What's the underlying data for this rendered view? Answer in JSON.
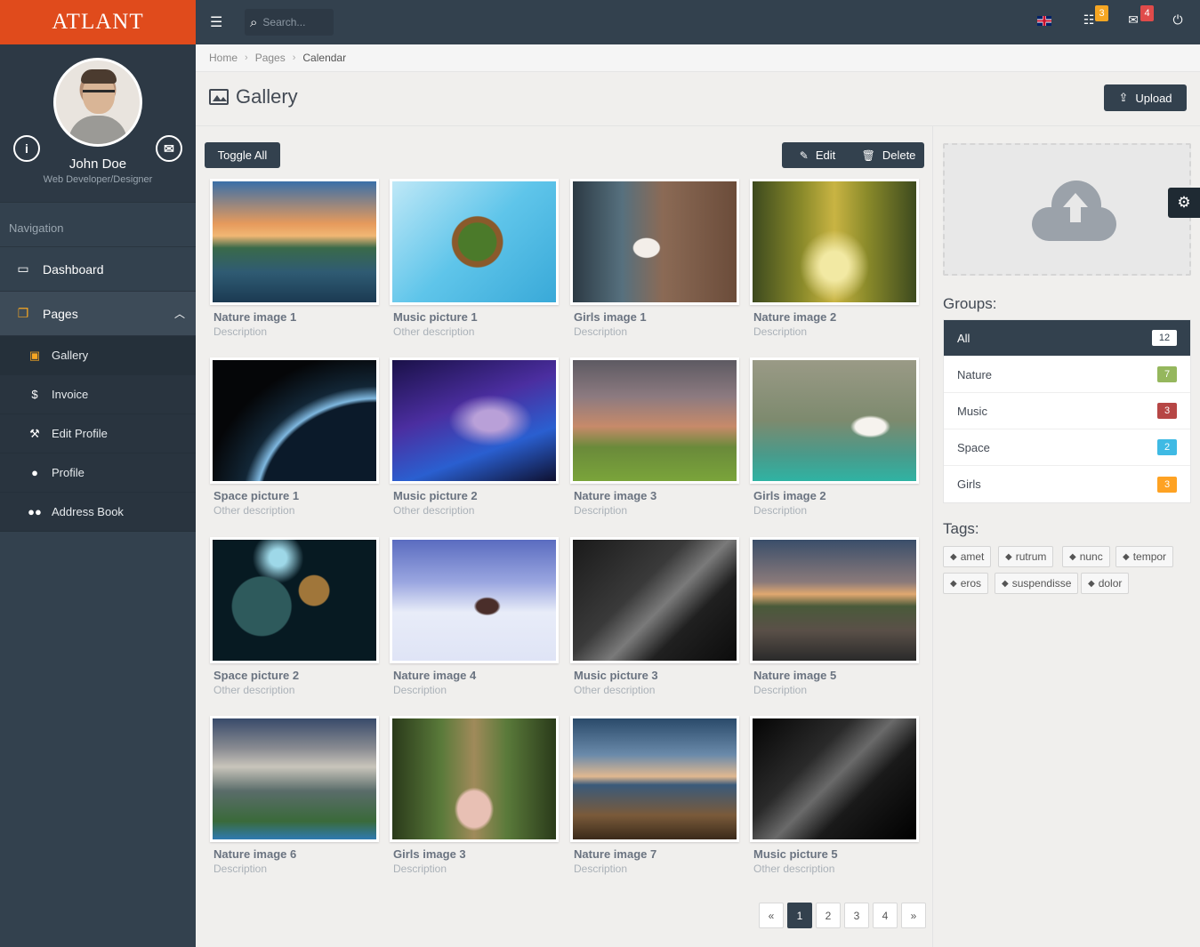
{
  "app": {
    "logo": "ATLANT"
  },
  "profile": {
    "name": "John Doe",
    "role": "Web Developer/Designer"
  },
  "nav": {
    "title": "Navigation",
    "items": [
      {
        "label": "Dashboard",
        "icon": "desktop-icon"
      },
      {
        "label": "Pages",
        "icon": "files-icon"
      }
    ],
    "sub_items": [
      {
        "label": "Gallery",
        "icon": "picture-icon"
      },
      {
        "label": "Invoice",
        "icon": "dollar-icon"
      },
      {
        "label": "Edit Profile",
        "icon": "wrench-icon"
      },
      {
        "label": "Profile",
        "icon": "user-icon"
      },
      {
        "label": "Address Book",
        "icon": "users-icon"
      }
    ]
  },
  "topbar": {
    "search_placeholder": "Search...",
    "tasks_badge": "3",
    "messages_badge": "4",
    "colors": {
      "orange": "#f6a623",
      "red": "#e04b4a"
    }
  },
  "breadcrumb": {
    "items": [
      "Home",
      "Pages"
    ],
    "current": "Calendar"
  },
  "page": {
    "title": "Gallery",
    "upload_label": "Upload"
  },
  "toolbar": {
    "toggle_all": "Toggle All",
    "edit": "Edit",
    "delete": "Delete"
  },
  "gallery": [
    {
      "title": "Nature image 1",
      "description": "Description",
      "img": "nature-lake-sunset"
    },
    {
      "title": "Music picture 1",
      "description": "Other description",
      "img": "music-note-art"
    },
    {
      "title": "Girls image 1",
      "description": "Description",
      "img": "girl-window"
    },
    {
      "title": "Nature image 2",
      "description": "Description",
      "img": "autumn-alley"
    },
    {
      "title": "Space picture 1",
      "description": "Other description",
      "img": "earth-horizon"
    },
    {
      "title": "Music picture 2",
      "description": "Other description",
      "img": "dj-lights"
    },
    {
      "title": "Nature image 3",
      "description": "Description",
      "img": "storm-clouds"
    },
    {
      "title": "Girls image 2",
      "description": "Description",
      "img": "girl-rocks"
    },
    {
      "title": "Space picture 2",
      "description": "Other description",
      "img": "planets"
    },
    {
      "title": "Nature image 4",
      "description": "Description",
      "img": "snow-house"
    },
    {
      "title": "Music picture 3",
      "description": "Other description",
      "img": "mixer-hands"
    },
    {
      "title": "Nature image 5",
      "description": "Description",
      "img": "beach-boat"
    },
    {
      "title": "Nature image 6",
      "description": "Description",
      "img": "canyon-clouds"
    },
    {
      "title": "Girls image 3",
      "description": "Description",
      "img": "girl-forest"
    },
    {
      "title": "Nature image 7",
      "description": "Description",
      "img": "lake-reeds"
    },
    {
      "title": "Music picture 5",
      "description": "Other description",
      "img": "mixer-knobs"
    }
  ],
  "pagination": {
    "prev": "«",
    "pages": [
      "1",
      "2",
      "3",
      "4"
    ],
    "next": "»",
    "current": "1"
  },
  "groups": {
    "title": "Groups:",
    "items": [
      {
        "label": "All",
        "count": "12",
        "color": "#ffffff"
      },
      {
        "label": "Nature",
        "count": "7",
        "color": "#95b75d"
      },
      {
        "label": "Music",
        "count": "3",
        "color": "#b64645"
      },
      {
        "label": "Space",
        "count": "2",
        "color": "#3fbae4"
      },
      {
        "label": "Girls",
        "count": "3",
        "color": "#fea223"
      }
    ]
  },
  "tags": {
    "title": "Tags:",
    "items": [
      "amet",
      "rutrum",
      "nunc",
      "tempor",
      "eros",
      "suspendisse",
      "dolor"
    ]
  }
}
